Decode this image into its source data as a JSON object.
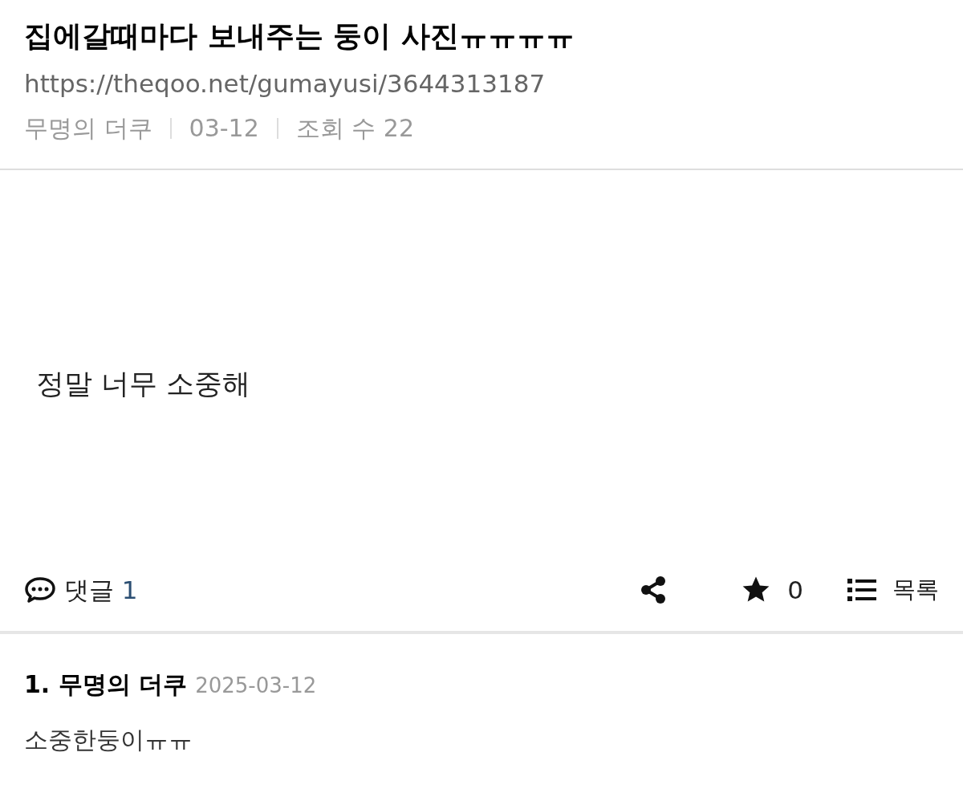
{
  "post": {
    "title": "집에갈때마다 보내주는 둥이 사진ㅠㅠㅠㅠ",
    "url": "https://theqoo.net/gumayusi/3644313187",
    "meta": [
      "무명의 더쿠",
      "03-12",
      "조회 수 22"
    ],
    "body": "정말 너무 소중해"
  },
  "actions": {
    "comments_label": "댓글",
    "comments_count": "1",
    "star_count": "0",
    "list_label": "목록"
  },
  "comments": [
    {
      "number": "1.",
      "author": "무명의 더쿠",
      "date": "2025-03-12",
      "text": "소중한둥이ㅠㅠ"
    }
  ]
}
